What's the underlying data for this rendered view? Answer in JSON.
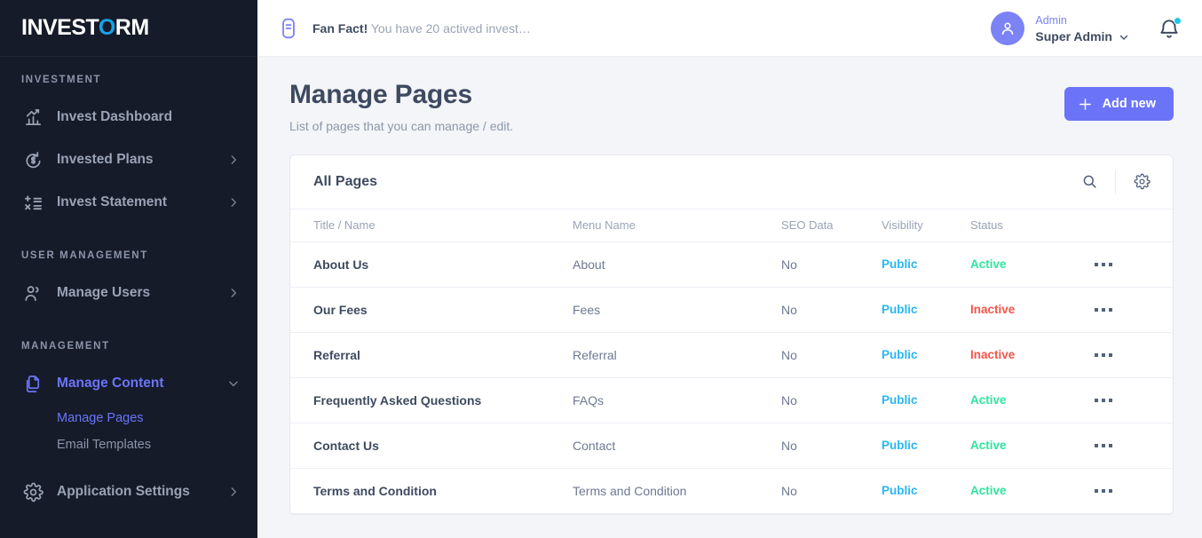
{
  "brand": {
    "name_prefix": "INVEST",
    "name_accent": "O",
    "name_suffix": "RM"
  },
  "sidebar": {
    "sections": [
      {
        "title": "INVESTMENT"
      },
      {
        "title": "USER MANAGEMENT"
      },
      {
        "title": "MANAGEMENT"
      }
    ],
    "investment_items": [
      {
        "label": "Invest Dashboard",
        "icon": "chart-bar-icon",
        "has_chevron": false
      },
      {
        "label": "Invested Plans",
        "icon": "refresh-dollar-icon",
        "has_chevron": true
      },
      {
        "label": "Invest Statement",
        "icon": "calculator-icon",
        "has_chevron": true
      }
    ],
    "user_items": [
      {
        "label": "Manage Users",
        "icon": "users-icon",
        "has_chevron": true
      }
    ],
    "management_items": [
      {
        "label": "Manage Content",
        "icon": "documents-icon",
        "has_chevron": true,
        "active": true
      },
      {
        "label": "Application Settings",
        "icon": "gear-icon",
        "has_chevron": true,
        "active": false
      }
    ],
    "content_subitems": [
      {
        "label": "Manage Pages",
        "active": true
      },
      {
        "label": "Email Templates",
        "active": false
      }
    ]
  },
  "topbar": {
    "fanfact_label": "Fan Fact!",
    "fanfact_text": "You have 20 actived invest…",
    "user_role": "Admin",
    "user_name": "Super Admin"
  },
  "page": {
    "title": "Manage Pages",
    "subtitle": "List of pages that you can manage / edit.",
    "add_new_label": "Add new"
  },
  "card": {
    "title": "All Pages",
    "columns": [
      "Title / Name",
      "Menu Name",
      "SEO Data",
      "Visibility",
      "Status"
    ],
    "rows": [
      {
        "title": "About Us",
        "menu": "About",
        "seo": "No",
        "visibility": "Public",
        "status": "Active"
      },
      {
        "title": "Our Fees",
        "menu": "Fees",
        "seo": "No",
        "visibility": "Public",
        "status": "Inactive"
      },
      {
        "title": "Referral",
        "menu": "Referral",
        "seo": "No",
        "visibility": "Public",
        "status": "Inactive"
      },
      {
        "title": "Frequently Asked Questions",
        "menu": "FAQs",
        "seo": "No",
        "visibility": "Public",
        "status": "Active"
      },
      {
        "title": "Contact Us",
        "menu": "Contact",
        "seo": "No",
        "visibility": "Public",
        "status": "Active"
      },
      {
        "title": "Terms and Condition",
        "menu": "Terms and Condition",
        "seo": "No",
        "visibility": "Public",
        "status": "Active"
      }
    ]
  },
  "colors": {
    "sidebar_bg": "#151b28",
    "accent": "#6b74f8",
    "visibility": "#29b6f6",
    "active": "#2ee6a0",
    "inactive": "#f4554a",
    "logo_accent": "#17a3e8",
    "notification_dot": "#1ec8e8"
  }
}
